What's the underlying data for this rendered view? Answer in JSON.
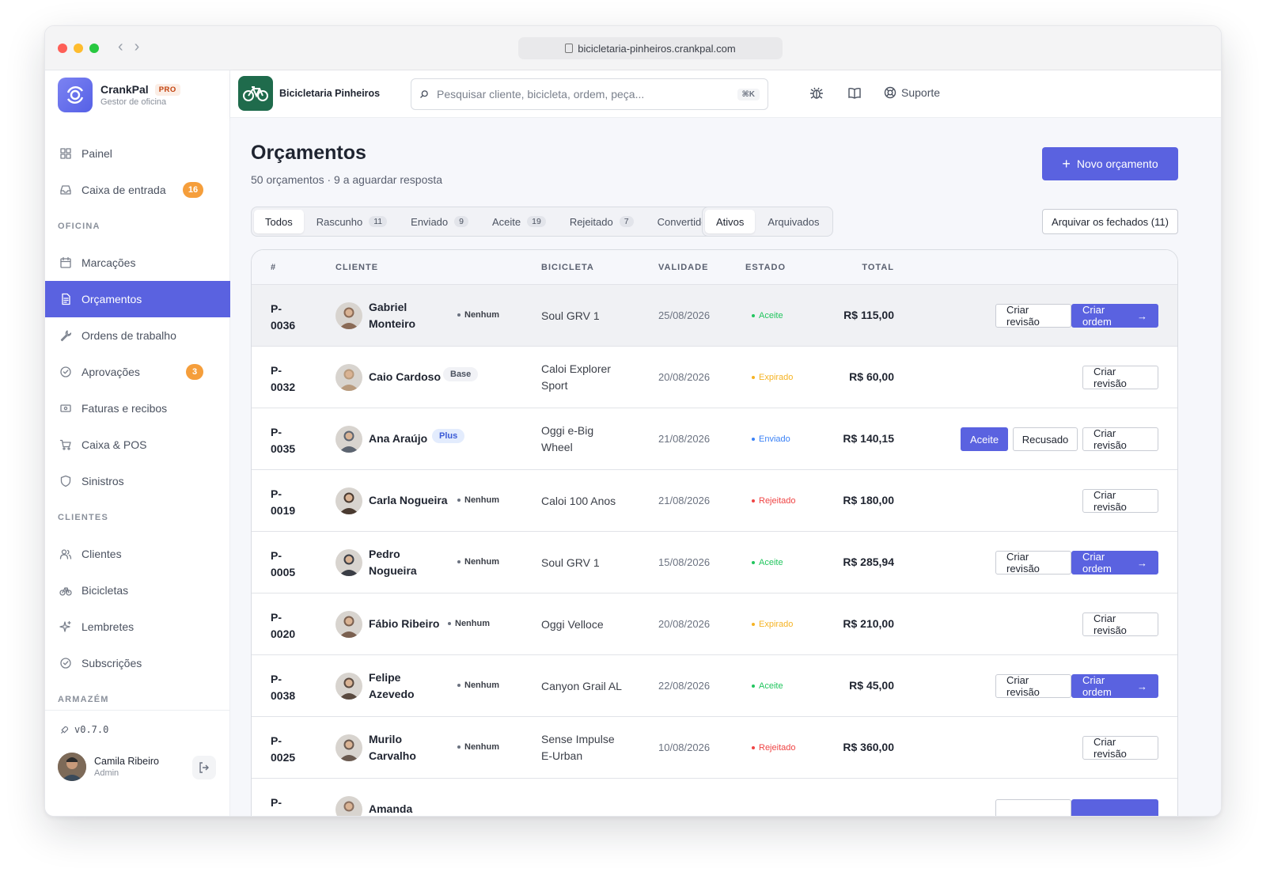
{
  "browser": {
    "url": "bicicletaria-pinheiros.crankpal.com",
    "traffic_colors": [
      "#fe5f57",
      "#febc2e",
      "#28c840"
    ]
  },
  "brand": {
    "name": "CrankPal",
    "badge": "PRO",
    "subtitle": "Gestor de oficina",
    "accent": "#5a62e0"
  },
  "sidebar": {
    "items": [
      {
        "id": "painel",
        "label": "Painel",
        "icon": "grid-icon"
      },
      {
        "id": "caixa-entrada",
        "label": "Caixa de entrada",
        "icon": "inbox-icon",
        "badge": "16"
      },
      {
        "section": "OFICINA"
      },
      {
        "id": "marcacoes",
        "label": "Marcações",
        "icon": "calendar-icon"
      },
      {
        "id": "orcamentos",
        "label": "Orçamentos",
        "icon": "document-icon",
        "active": true
      },
      {
        "id": "ordens",
        "label": "Ordens de trabalho",
        "icon": "wrench-icon"
      },
      {
        "id": "aprovacoes",
        "label": "Aprovações",
        "icon": "check-circle-icon",
        "badge": "3"
      },
      {
        "id": "faturas",
        "label": "Faturas e recibos",
        "icon": "receipt-icon"
      },
      {
        "id": "caixa-pos",
        "label": "Caixa & POS",
        "icon": "cart-icon"
      },
      {
        "id": "sinistros",
        "label": "Sinistros",
        "icon": "shield-icon"
      },
      {
        "section": "CLIENTES"
      },
      {
        "id": "clientes",
        "label": "Clientes",
        "icon": "users-icon"
      },
      {
        "id": "bicicletas",
        "label": "Bicicletas",
        "icon": "bike-icon"
      },
      {
        "id": "lembretes",
        "label": "Lembretes",
        "icon": "sparkle-icon"
      },
      {
        "id": "subscricoes",
        "label": "Subscrições",
        "icon": "check-circle-icon"
      },
      {
        "section": "ARMAZÉM"
      }
    ],
    "version": "v0.7.0",
    "user": {
      "name": "Camila Ribeiro",
      "role": "Admin"
    }
  },
  "topbar": {
    "shop_name": "Bicicletaria Pinheiros",
    "search_placeholder": "Pesquisar cliente, bicicleta, ordem, peça...",
    "search_shortcut": "⌘K",
    "support_label": "Suporte"
  },
  "page": {
    "title": "Orçamentos",
    "subtitle": "50 orçamentos · 9 a aguardar resposta",
    "new_button": "Novo orçamento",
    "archive_button": "Arquivar os fechados (11)"
  },
  "status_tabs": [
    {
      "label": "Todos",
      "active": true
    },
    {
      "label": "Rascunho",
      "count": "11"
    },
    {
      "label": "Enviado",
      "count": "9"
    },
    {
      "label": "Aceite",
      "count": "19"
    },
    {
      "label": "Rejeitado",
      "count": "7"
    },
    {
      "label": "Convertido"
    }
  ],
  "scope_tabs": [
    {
      "label": "Ativos",
      "active": true
    },
    {
      "label": "Arquivados"
    }
  ],
  "table": {
    "headers": [
      "#",
      "CLIENTE",
      "BICICLETA",
      "VALIDADE",
      "ESTADO",
      "TOTAL"
    ],
    "status_colors": {
      "Aceite": "#22c55e",
      "Expirado": "#f5b324",
      "Enviado": "#3b82f6",
      "Rejeitado": "#ef4444"
    },
    "rows": [
      {
        "id": [
          "P-",
          "0036"
        ],
        "name": [
          "Gabriel",
          "Monteiro"
        ],
        "tier": "Nenhum",
        "bike": [
          "Soul GRV 1"
        ],
        "date": "25/08/2026",
        "status": "Aceite",
        "total": "R$ 115,00",
        "actions": [
          "Criar revisão",
          "Criar ordem"
        ],
        "hover": true,
        "avatar_color": "#8a6a55"
      },
      {
        "id": [
          "P-",
          "0032"
        ],
        "name": [
          "Caio Cardoso"
        ],
        "tier": "Base",
        "bike": [
          "Caloi Explorer",
          "Sport"
        ],
        "date": "20/08/2026",
        "status": "Expirado",
        "total": "R$ 60,00",
        "actions": [
          "Criar revisão"
        ],
        "avatar_color": "#b89a7d"
      },
      {
        "id": [
          "P-",
          "0035"
        ],
        "name": [
          "Ana Araújo"
        ],
        "tier": "Plus",
        "bike": [
          "Oggi e-Big",
          "Wheel"
        ],
        "date": "21/08/2026",
        "status": "Enviado",
        "total": "R$ 140,15",
        "actions": [
          "Aceite",
          "Recusado",
          "Criar revisão"
        ],
        "avatar_color": "#5c6470"
      },
      {
        "id": [
          "P-",
          "0019"
        ],
        "name": [
          "Carla Nogueira"
        ],
        "tier": "Nenhum",
        "bike": [
          "Caloi 100 Anos"
        ],
        "date": "21/08/2026",
        "status": "Rejeitado",
        "total": "R$ 180,00",
        "actions": [
          "Criar revisão"
        ],
        "avatar_color": "#4a3a30"
      },
      {
        "id": [
          "P-",
          "0005"
        ],
        "name": [
          "Pedro",
          "Nogueira"
        ],
        "tier": "Nenhum",
        "bike": [
          "Soul GRV 1"
        ],
        "date": "15/08/2026",
        "status": "Aceite",
        "total": "R$ 285,94",
        "actions": [
          "Criar revisão",
          "Criar ordem"
        ],
        "avatar_color": "#3a3d45"
      },
      {
        "id": [
          "P-",
          "0020"
        ],
        "name": [
          "Fábio Ribeiro"
        ],
        "tier": "Nenhum",
        "bike": [
          "Oggi Velloce"
        ],
        "date": "20/08/2026",
        "status": "Expirado",
        "total": "R$ 210,00",
        "actions": [
          "Criar revisão"
        ],
        "avatar_color": "#7a6050"
      },
      {
        "id": [
          "P-",
          "0038"
        ],
        "name": [
          "Felipe",
          "Azevedo"
        ],
        "tier": "Nenhum",
        "bike": [
          "Canyon Grail AL"
        ],
        "date": "22/08/2026",
        "status": "Aceite",
        "total": "R$ 45,00",
        "actions": [
          "Criar revisão",
          "Criar ordem"
        ],
        "avatar_color": "#5a4a40"
      },
      {
        "id": [
          "P-",
          "0025"
        ],
        "name": [
          "Murilo",
          "Carvalho"
        ],
        "tier": "Nenhum",
        "bike": [
          "Sense Impulse",
          "E-Urban"
        ],
        "date": "10/08/2026",
        "status": "Rejeitado",
        "total": "R$ 360,00",
        "actions": [
          "Criar revisão"
        ],
        "avatar_color": "#6a5a50"
      },
      {
        "id": [
          "P-"
        ],
        "name": [
          "Amanda"
        ],
        "tier": "",
        "bike": [
          ""
        ],
        "date": "",
        "status": "",
        "total": "",
        "actions": [
          "",
          ""
        ],
        "avatar_color": "#8a7060"
      }
    ]
  }
}
